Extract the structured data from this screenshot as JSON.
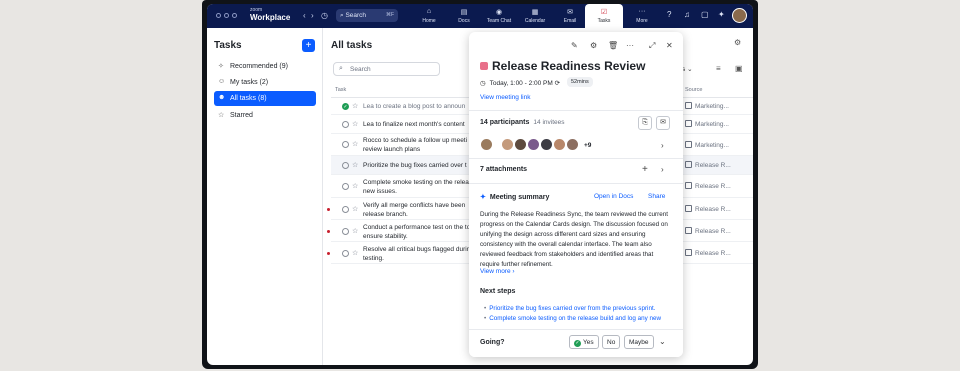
{
  "app": {
    "brand_small": "zoom",
    "brand": "Workplace"
  },
  "topbar": {
    "search_label": "Search",
    "search_shortcut": "⌘F",
    "tabs": [
      {
        "label": "Home",
        "icon": "home-icon"
      },
      {
        "label": "Docs",
        "icon": "docs-icon"
      },
      {
        "label": "Team Chat",
        "icon": "chat-icon"
      },
      {
        "label": "Calendar",
        "icon": "calendar-icon"
      },
      {
        "label": "Email",
        "icon": "email-icon"
      },
      {
        "label": "Tasks",
        "icon": "tasks-icon"
      },
      {
        "label": "More",
        "icon": "more-icon"
      }
    ],
    "active_tab": "Tasks"
  },
  "sidebar": {
    "title": "Tasks",
    "items": [
      {
        "label": "Recommended (9)",
        "icon": "sparkle-icon"
      },
      {
        "label": "My tasks (2)",
        "icon": "person-icon"
      },
      {
        "label": "All tasks (8)",
        "icon": "people-icon"
      },
      {
        "label": "Starred",
        "icon": "star-icon"
      }
    ],
    "active_item": "All tasks (8)"
  },
  "main": {
    "title": "All tasks",
    "search_placeholder": "Search",
    "col_task": "Task",
    "col_source": "Source",
    "sources_label": "rces",
    "rows": [
      {
        "text": "Lea to create a blog post to announ",
        "done": true,
        "source": "Marketing...",
        "priority": false
      },
      {
        "text": "Lea to finalize next month's content",
        "done": false,
        "source": "Marketing...",
        "priority": false
      },
      {
        "text": "Rocco to schedule a follow up meeti review launch plans",
        "done": false,
        "source": "Marketing...",
        "priority": false
      },
      {
        "text": "Prioritize the bug fixes carried over t",
        "done": false,
        "source": "Release R...",
        "priority": false
      },
      {
        "text": "Complete smoke testing on the relea new issues.",
        "done": false,
        "source": "Release R...",
        "priority": false
      },
      {
        "text": "Verify all merge conflicts have been release branch.",
        "done": false,
        "source": "Release R...",
        "priority": true
      },
      {
        "text": "Conduct a performance test on the to ensure stability.",
        "done": false,
        "source": "Release R...",
        "priority": true
      },
      {
        "text": "Resolve all critical bugs flagged durir testing.",
        "done": false,
        "source": "Release R...",
        "priority": true
      }
    ]
  },
  "panel": {
    "title": "Release Readiness Review",
    "time": "Today, 1:00 - 2:00 PM",
    "duration": "52mins",
    "meeting_link": "View meeting link",
    "participants_label": "14 participants",
    "invitees_label": "14 invitees",
    "more_avatars": "+9",
    "attachments_label": "7 attachments",
    "summary_title": "Meeting summary",
    "open_in_docs": "Open in Docs",
    "share": "Share",
    "summary_text": "During the Release Readiness Sync, the team reviewed the current progress on the Calendar Cards design. The discussion focused on unifying the design across different card sizes and ensuring consistency with the overall calendar interface. The team also reviewed feedback from stakeholders and identified areas that require further refinement.",
    "view_more": "View more",
    "next_steps_title": "Next steps",
    "next_steps": [
      "Prioritize the bug fixes carried over from the previous sprint.",
      "Complete smoke testing on the release build and log any new"
    ],
    "going_label": "Going?",
    "rsvp": [
      "Yes",
      "No",
      "Maybe"
    ]
  },
  "colors": {
    "accent": "#0b5cff",
    "topbar": "#0b1a4f",
    "done": "#1f9d55",
    "priority": "#c8202f",
    "event": "#e8708a"
  }
}
